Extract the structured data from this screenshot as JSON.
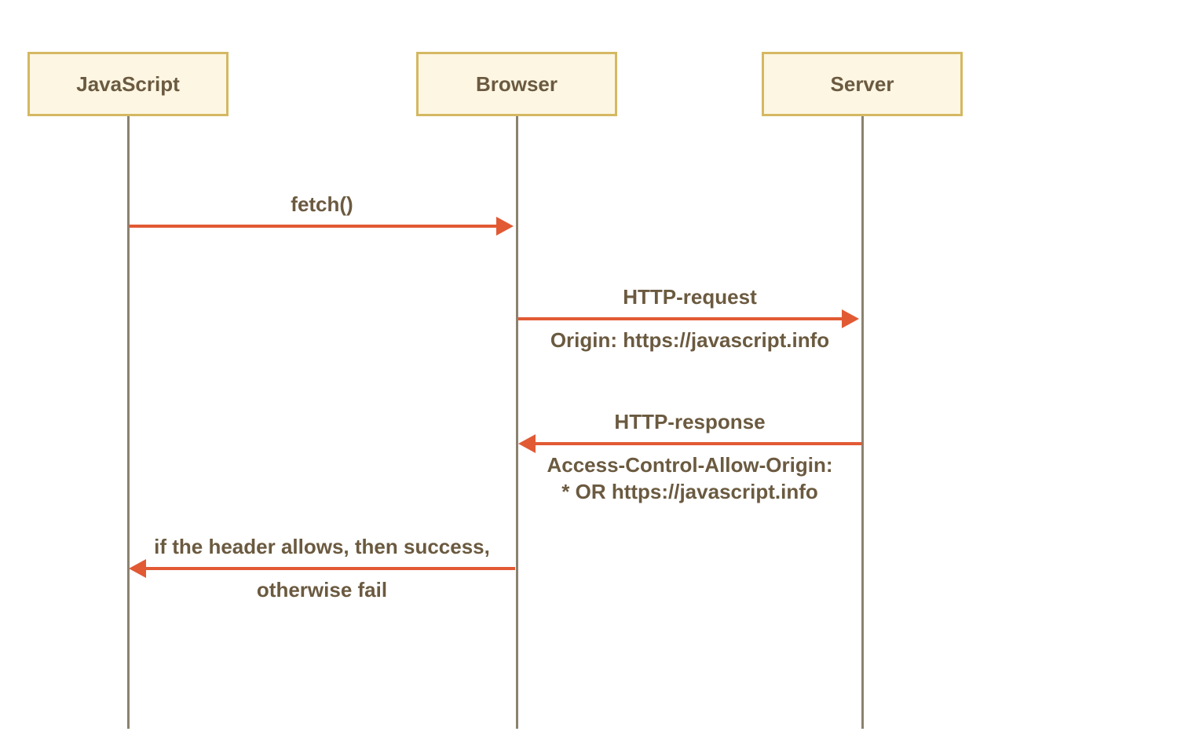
{
  "participants": {
    "javascript": "JavaScript",
    "browser": "Browser",
    "server": "Server"
  },
  "messages": {
    "m1_label": "fetch()",
    "m2_label_top": "HTTP-request",
    "m2_label_bottom": "Origin: https://javascript.info",
    "m3_label_top": "HTTP-response",
    "m3_label_bottom_l1": "Access-Control-Allow-Origin:",
    "m3_label_bottom_l2": "* OR https://javascript.info",
    "m4_label_top": "if the header allows, then success,",
    "m4_label_bottom": "otherwise fail"
  },
  "colors": {
    "box_bg": "#FDF6E3",
    "box_border": "#D4B862",
    "lifeline": "#8A8270",
    "arrow": "#E15A34",
    "text": "#6B5A40"
  }
}
